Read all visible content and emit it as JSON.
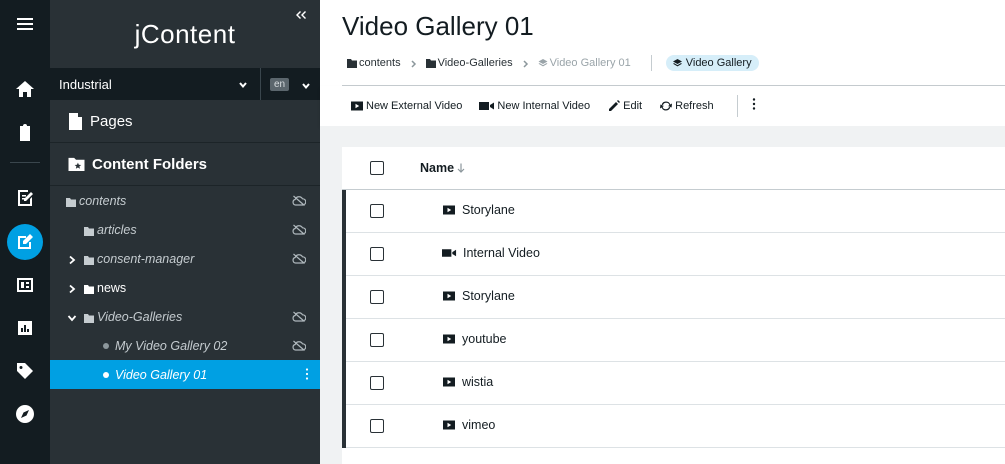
{
  "app": {
    "logo": "jContent"
  },
  "rail": {
    "items": [
      {
        "name": "menu-icon"
      },
      {
        "name": "home-icon"
      },
      {
        "name": "clipboard-icon"
      },
      {
        "name": "page-composer-icon"
      },
      {
        "name": "jcontent-icon",
        "active": true
      },
      {
        "name": "dashboard-icon"
      },
      {
        "name": "reports-icon"
      },
      {
        "name": "tag-icon"
      },
      {
        "name": "compass-icon"
      }
    ]
  },
  "nav": {
    "site": "Industrial",
    "language": "en",
    "pages_label": "Pages",
    "folders_label": "Content Folders",
    "tree": [
      {
        "label": "contents",
        "level": 0,
        "italic": true,
        "arrow": "none",
        "icon": "folder",
        "cloud": true
      },
      {
        "label": "articles",
        "level": 1,
        "italic": true,
        "arrow": "none",
        "icon": "folder",
        "cloud": true
      },
      {
        "label": "consent-manager",
        "level": 1,
        "italic": true,
        "arrow": "right",
        "icon": "folder",
        "cloud": true
      },
      {
        "label": "news",
        "level": 1,
        "italic": false,
        "arrow": "right",
        "icon": "folder",
        "cloud": false
      },
      {
        "label": "Video-Galleries",
        "level": 1,
        "italic": true,
        "arrow": "down",
        "icon": "folder",
        "cloud": true
      },
      {
        "label": "My Video Gallery 02",
        "level": 2,
        "italic": true,
        "arrow": "none",
        "icon": "dot",
        "cloud": true
      },
      {
        "label": "Video Gallery 01",
        "level": 2,
        "italic": true,
        "arrow": "none",
        "icon": "dot",
        "cloud": false,
        "selected": true
      }
    ]
  },
  "main": {
    "title": "Video Gallery 01",
    "breadcrumb": [
      "contents",
      "Video-Galleries",
      "Video Gallery 01"
    ],
    "type_badge": "Video Gallery",
    "toolbar": {
      "new_external": "New External Video",
      "new_internal": "New Internal Video",
      "edit": "Edit",
      "refresh": "Refresh"
    },
    "table": {
      "col_name": "Name",
      "rows": [
        {
          "name": "Storylane",
          "icon": "youtube"
        },
        {
          "name": "Internal Video",
          "icon": "video"
        },
        {
          "name": "Storylane",
          "icon": "youtube"
        },
        {
          "name": "youtube",
          "icon": "youtube"
        },
        {
          "name": "wistia",
          "icon": "youtube"
        },
        {
          "name": "vimeo",
          "icon": "youtube"
        }
      ]
    }
  },
  "colors": {
    "accent": "#00a0e3",
    "rail_bg": "#131c21",
    "nav_bg": "#293136",
    "badge_bg": "#d6eef9"
  }
}
